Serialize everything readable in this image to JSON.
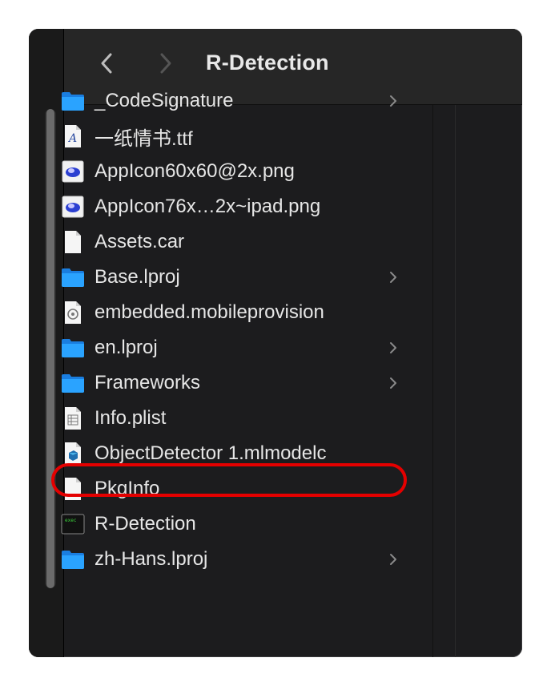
{
  "window": {
    "title": "R-Detection",
    "nav": {
      "back_icon": "chevron-left-icon",
      "forward_icon": "chevron-right-icon"
    }
  },
  "files": [
    {
      "name": "_CodeSignature",
      "icon": "folder-icon",
      "kind": "folder"
    },
    {
      "name": "一纸情书.ttf",
      "icon": "font-file-icon",
      "kind": "file"
    },
    {
      "name": "AppIcon60x60@2x.png",
      "icon": "image-file-icon",
      "kind": "file"
    },
    {
      "name": "AppIcon76x…2x~ipad.png",
      "icon": "image-file-icon",
      "kind": "file"
    },
    {
      "name": "Assets.car",
      "icon": "document-icon",
      "kind": "file"
    },
    {
      "name": "Base.lproj",
      "icon": "folder-icon",
      "kind": "folder"
    },
    {
      "name": "embedded.mobileprovision",
      "icon": "provision-file-icon",
      "kind": "file"
    },
    {
      "name": "en.lproj",
      "icon": "folder-icon",
      "kind": "folder"
    },
    {
      "name": "Frameworks",
      "icon": "folder-icon",
      "kind": "folder"
    },
    {
      "name": "Info.plist",
      "icon": "plist-file-icon",
      "kind": "file"
    },
    {
      "name": "ObjectDetector 1.mlmodelc",
      "icon": "mlmodel-file-icon",
      "kind": "file"
    },
    {
      "name": "PkgInfo",
      "icon": "document-icon",
      "kind": "file"
    },
    {
      "name": "R-Detection",
      "icon": "executable-icon",
      "kind": "file"
    },
    {
      "name": "zh-Hans.lproj",
      "icon": "folder-icon",
      "kind": "folder"
    }
  ],
  "annotation": {
    "highlighted_item": "ObjectDetector 1.mlmodelc",
    "color": "#e40000"
  },
  "colors": {
    "folder": "#1e90ff",
    "window_bg": "#1c1c1e",
    "text": "#e6e6e6"
  }
}
